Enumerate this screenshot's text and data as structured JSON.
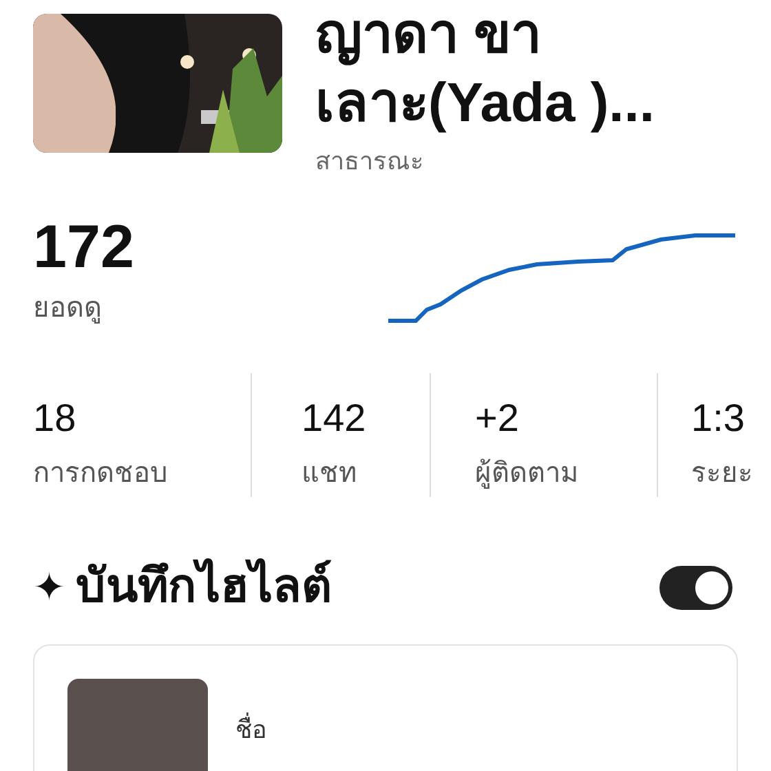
{
  "header": {
    "title_lines": [
      "ญาดา ขา",
      "เลาะ(Yada )..."
    ],
    "visibility": "สาธารณะ"
  },
  "views": {
    "value": "172",
    "label": "ยอดดู"
  },
  "stats": [
    {
      "value": "18",
      "label": "การกดชอบ"
    },
    {
      "value": "142",
      "label": "แชท"
    },
    {
      "value": "+2",
      "label": "ผู้ติดตาม"
    },
    {
      "value": "1:3",
      "label": "ระยะ"
    }
  ],
  "highlights": {
    "icon": "✦",
    "title": "บันทึกไฮไลต์",
    "toggle": {
      "on": true
    },
    "item": {
      "name_label": "ชื่อ"
    }
  }
}
